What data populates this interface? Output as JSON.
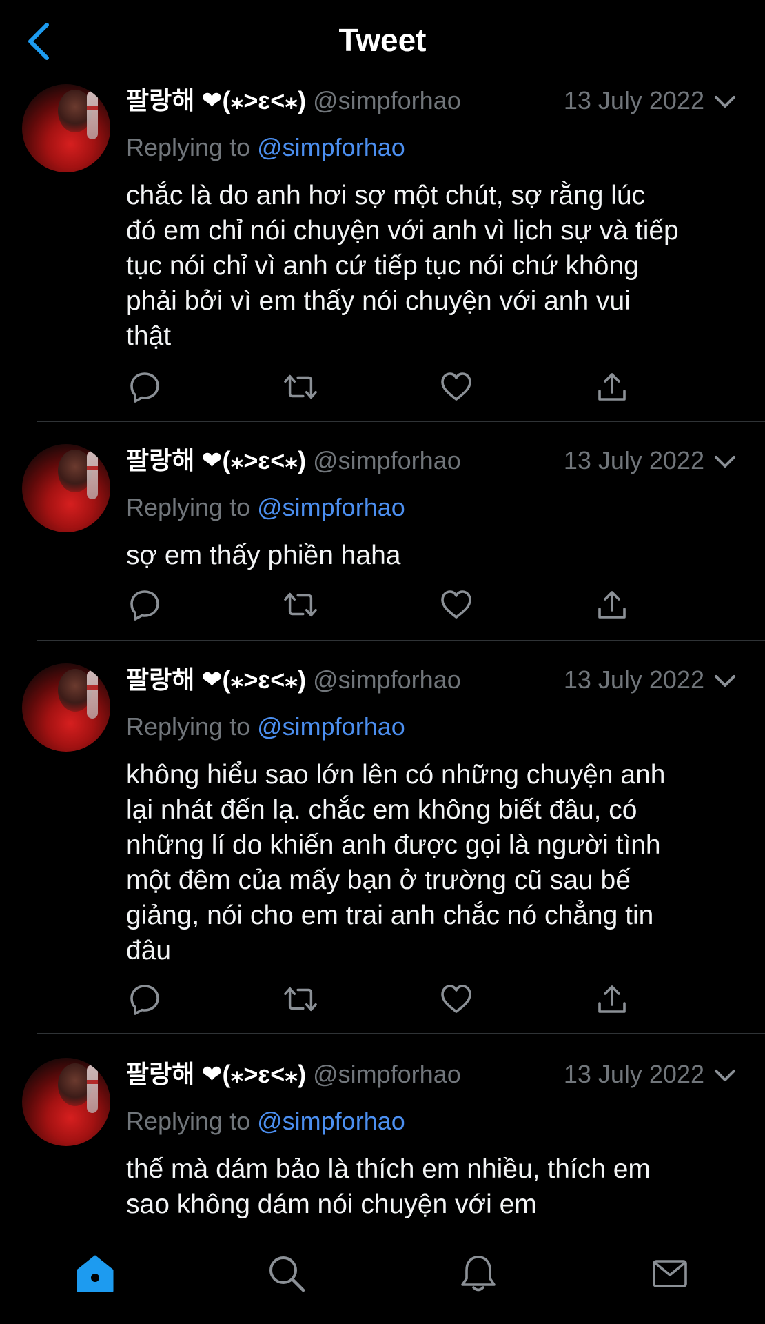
{
  "header": {
    "title": "Tweet",
    "back_icon": "chevron-left-icon"
  },
  "colors": {
    "background": "#000000",
    "accent": "#1d9bf0",
    "link": "#4c8ff0",
    "muted": "#71767b"
  },
  "tweets": [
    {
      "name": "팔랑해 ❤(⁎˃ɛ˂⁎)",
      "handle": "@simpforhao",
      "date": "13 July 2022",
      "replying_prefix": "Replying to",
      "replying_to": "@simpforhao",
      "lines": [
        "chắc là do anh hơi sợ một chút, sợ rằng lúc",
        "đó em chỉ nói chuyện với anh vì lịch sự và tiếp",
        "tục nói chỉ vì anh cứ tiếp tục nói chứ không",
        "phải bởi vì em thấy nói chuyện với anh vui",
        "thật"
      ]
    },
    {
      "name": "팔랑해 ❤(⁎˃ɛ˂⁎)",
      "handle": "@simpforhao",
      "date": "13 July 2022",
      "replying_prefix": "Replying to",
      "replying_to": "@simpforhao",
      "lines": [
        "sợ em thấy phiền haha"
      ]
    },
    {
      "name": "팔랑해 ❤(⁎˃ɛ˂⁎)",
      "handle": "@simpforhao",
      "date": "13 July 2022",
      "replying_prefix": "Replying to",
      "replying_to": "@simpforhao",
      "lines": [
        "không hiểu sao lớn lên có những chuyện anh",
        "lại nhát đến lạ. chắc em không biết đâu, có",
        "những lí do khiến anh được gọi là người tình",
        "một đêm của mấy bạn ở trường cũ sau bế",
        "giảng, nói cho em trai anh chắc nó chẳng tin",
        "đâu"
      ]
    },
    {
      "name": "팔랑해 ❤(⁎˃ɛ˂⁎)",
      "handle": "@simpforhao",
      "date": "13 July 2022",
      "replying_prefix": "Replying to",
      "replying_to": "@simpforhao",
      "lines": [
        "thế mà dám bảo là thích em nhiều, thích em",
        "sao không dám nói chuyện với em"
      ]
    }
  ],
  "tabbar": {
    "items": [
      "home-icon",
      "search-icon",
      "notifications-icon",
      "messages-icon"
    ],
    "active": "home-icon"
  }
}
